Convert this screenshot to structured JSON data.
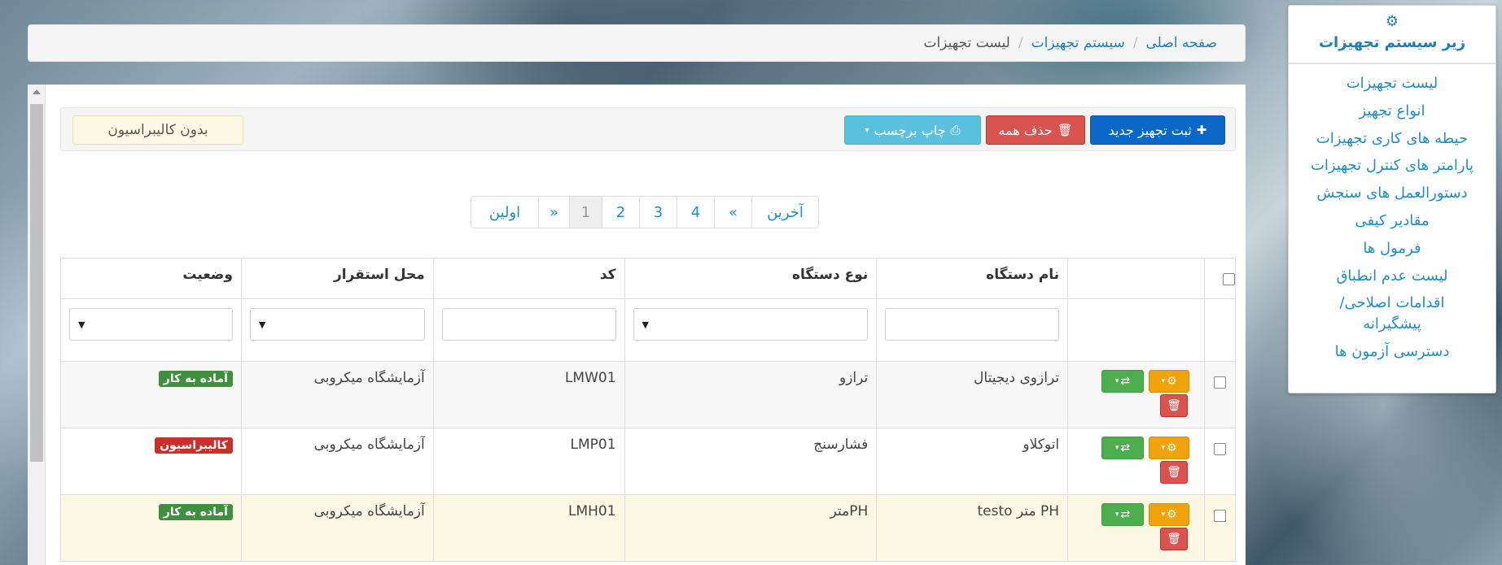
{
  "sidebar": {
    "title": "زیر سیستم تجهیزات",
    "items": [
      {
        "label": "لیست تجهیزات"
      },
      {
        "label": "انواع تجهیز"
      },
      {
        "label": "حیطه های کاری تجهیزات"
      },
      {
        "label": "پارامتر های کنترل تجهیزات"
      },
      {
        "label": "دستورالعمل های سنجش"
      },
      {
        "label": "مقادیر کیفی"
      },
      {
        "label": "فرمول ها"
      },
      {
        "label": "لیست عدم انطباق"
      },
      {
        "label": "اقدامات اصلاحی/ پیشگیرانه"
      },
      {
        "label": "دسترسی آزمون ها"
      }
    ]
  },
  "breadcrumb": {
    "home": "صفحه اصلی",
    "section": "سیستم تجهیزات",
    "current": "لیست تجهیزات",
    "separator": "/"
  },
  "toolbar": {
    "new_label": "ثبت تجهیز جدید",
    "delete_all_label": "حذف همه",
    "print_label": "چاپ برچسب",
    "no_calibration_label": "بدون کالیبراسیون"
  },
  "pagination": {
    "last": "آخرین",
    "prev": "«",
    "pages": [
      "4",
      "3",
      "2",
      "1"
    ],
    "next": "»",
    "first": "اولین"
  },
  "table": {
    "headers": {
      "device_name": "نام دستگاه",
      "device_type": "نوع دستگاه",
      "code": "کد",
      "location": "محل استقرار",
      "status": "وضعیت"
    },
    "rows": [
      {
        "name": "ترازوی دیجیتال",
        "type": "ترازو",
        "code": "LMW01",
        "location": "آزمایشگاه میکروبی",
        "status": "آماده به کار",
        "status_color": "#3e8f3e"
      },
      {
        "name": "اتوکلاو",
        "type": "فشارسنج",
        "code": "LMP01",
        "location": "آزمایشگاه میکروبی",
        "status": "کالیبراسیون",
        "status_color": "#c9302c"
      },
      {
        "name": "PH متر testo",
        "type": "PHمتر",
        "code": "LMH01",
        "location": "آزمایشگاه میکروبی",
        "status": "آماده به کار",
        "status_color": "#3e8f3e"
      }
    ]
  },
  "colors": {
    "primary": "#0a68c9",
    "danger": "#d9534f",
    "info": "#5bc0de",
    "warning": "#f0a30a",
    "success": "#4cae4c",
    "link": "#1c8fc8"
  },
  "icons": {
    "sidebar": "gear-icon",
    "new": "plus-icon",
    "delete": "trash-icon",
    "print": "print-icon",
    "row_settings": "gear-icon",
    "row_swap": "swap-icon",
    "row_delete": "trash-icon"
  }
}
